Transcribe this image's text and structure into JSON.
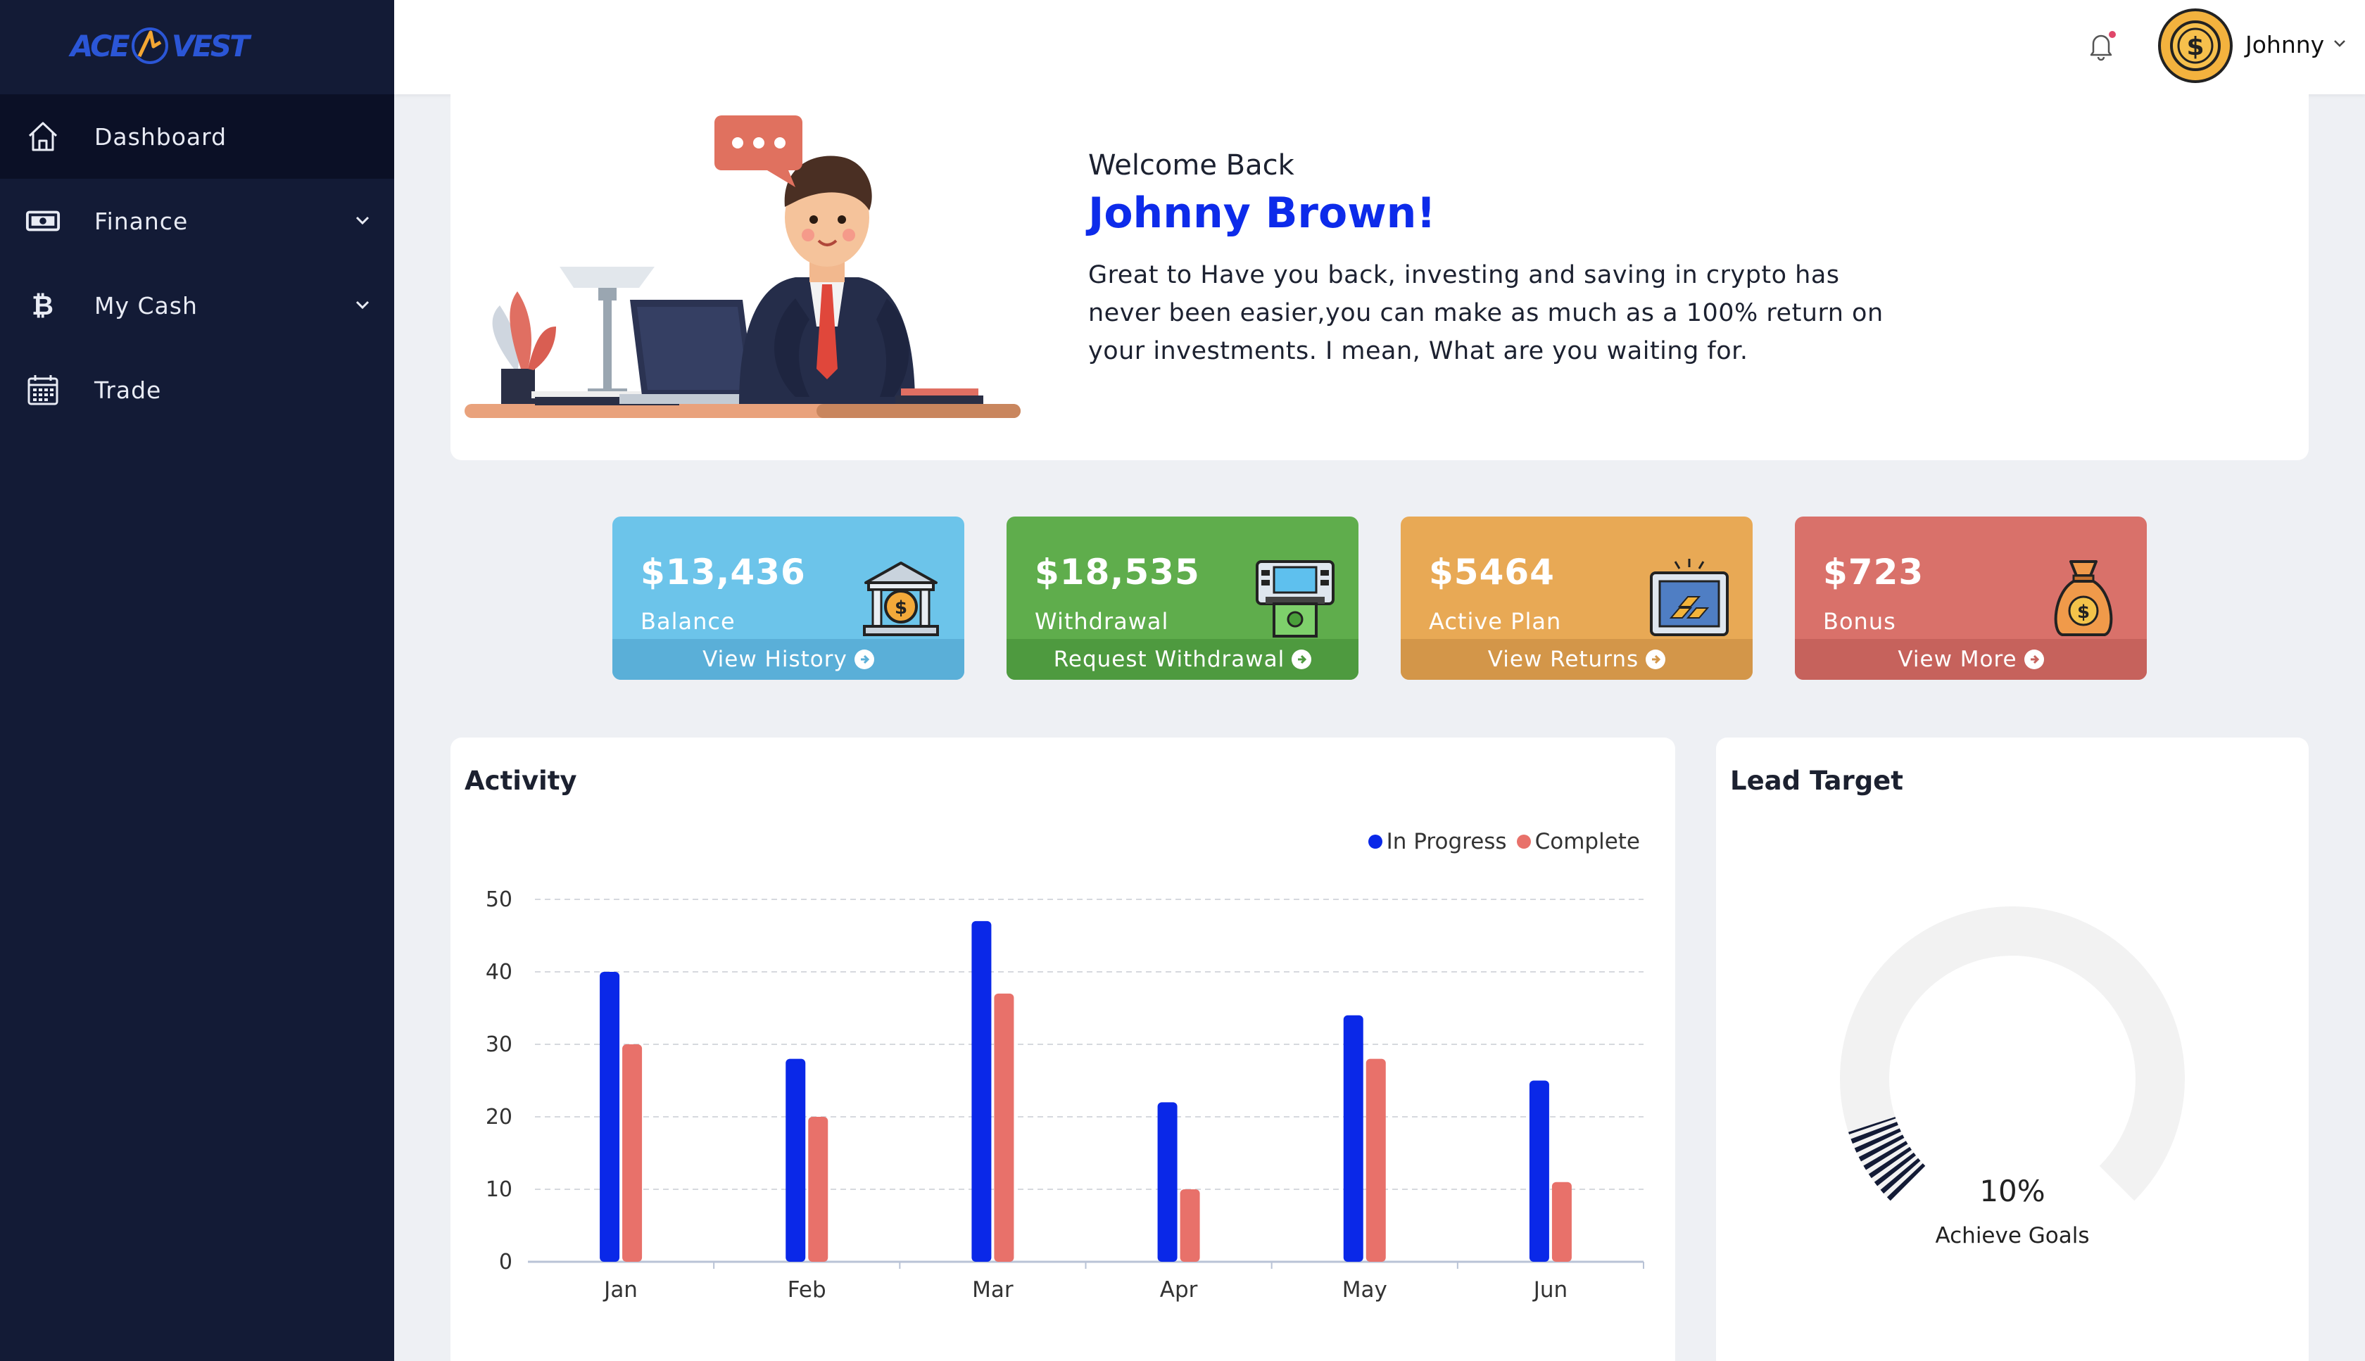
{
  "brand": {
    "logo_left": "ACE",
    "logo_right": "VEST"
  },
  "sidebar": {
    "items": [
      {
        "label": "Dashboard",
        "icon": "home-icon",
        "active": true,
        "has_submenu": false
      },
      {
        "label": "Finance",
        "icon": "banknote-icon",
        "active": false,
        "has_submenu": true
      },
      {
        "label": "My Cash",
        "icon": "bitcoin-icon",
        "active": false,
        "has_submenu": true
      },
      {
        "label": "Trade",
        "icon": "calendar-icon",
        "active": false,
        "has_submenu": false
      }
    ]
  },
  "header": {
    "username": "Johnny",
    "notification_icon": "bell-icon",
    "has_unread": true
  },
  "welcome": {
    "greeting": "Welcome Back",
    "name": "Johnny Brown!",
    "message": "Great to Have you back, investing and saving in crypto has never been easier,you can make as much as a 100% return on your investments. I mean, What are you waiting for."
  },
  "stats": [
    {
      "amount": "$13,436",
      "label": "Balance",
      "action": "View History",
      "color": "#6cc4ea",
      "foot_color": "#5aafd8",
      "icon": "bank-icon"
    },
    {
      "amount": "$18,535",
      "label": "Withdrawal",
      "action": "Request Withdrawal",
      "color": "#5fad4c",
      "foot_color": "#4e9a3f",
      "icon": "atm-icon"
    },
    {
      "amount": "$5464",
      "label": "Active Plan",
      "action": "View Returns",
      "color": "#e8a955",
      "foot_color": "#d39649",
      "icon": "gold-safe-icon"
    },
    {
      "amount": "$723",
      "label": "Bonus",
      "action": "View More",
      "color": "#d9716a",
      "foot_color": "#c6625c",
      "icon": "money-bag-icon"
    }
  ],
  "activity": {
    "title": "Activity",
    "legend": [
      "In Progress",
      "Complete"
    ]
  },
  "chart_data": {
    "type": "bar",
    "categories": [
      "Jan",
      "Feb",
      "Mar",
      "Apr",
      "May",
      "Jun"
    ],
    "series": [
      {
        "name": "In Progress",
        "values": [
          40,
          28,
          47,
          22,
          34,
          25
        ],
        "color": "#0a28e8"
      },
      {
        "name": "Complete",
        "values": [
          30,
          20,
          37,
          10,
          28,
          11
        ],
        "color": "#e8716a"
      }
    ],
    "yticks": [
      0,
      10,
      20,
      30,
      40,
      50
    ],
    "ylim": [
      0,
      50
    ],
    "grid": true,
    "legend_position": "top-right"
  },
  "lead": {
    "title": "Lead Target",
    "percent_label": "10%",
    "percent_value": 0.1,
    "caption": "Achieve Goals"
  }
}
